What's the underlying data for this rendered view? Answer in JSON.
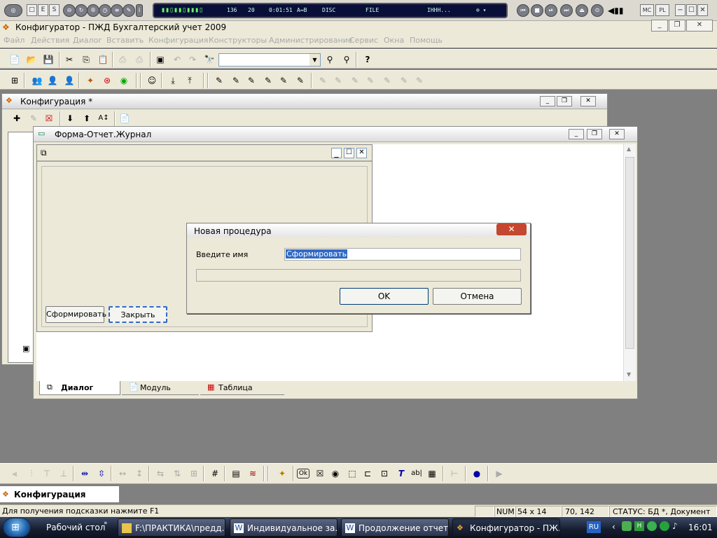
{
  "player": {
    "left_buttons": [
      "□",
      "E",
      "S"
    ],
    "lcd": {
      "track_no": "136",
      "kbps": "20",
      "time": "0:01:51",
      "ab": "A↔B",
      "disc": "DISC",
      "file": "FILE",
      "scroll": "ІННН..."
    },
    "right_buttons": [
      "MC",
      "PL"
    ]
  },
  "app": {
    "title": "Конфигуратор - ПЖД Бухгалтерский учет 2009",
    "menu": [
      "Файл",
      "Действия",
      "Диалог",
      "Вставить",
      "Конфигурация",
      "Конструкторы",
      "Администрирование",
      "Сервис",
      "Окна",
      "Помощь"
    ],
    "toolbar_combo_value": ""
  },
  "config_window": {
    "title": "Конфигурация *"
  },
  "form_window": {
    "title": "Форма-Отчет.Журнал",
    "buttons": {
      "form_button": "Сформировать",
      "close_button": "Закрыть"
    },
    "tabs": [
      {
        "label": "Диалог",
        "active": true,
        "icon": "dialog-icon"
      },
      {
        "label": "Модуль",
        "active": false,
        "icon": "module-icon"
      },
      {
        "label": "Таблица",
        "active": false,
        "icon": "table-icon"
      }
    ]
  },
  "dialog": {
    "title": "Новая процедура",
    "name_label": "Введите имя",
    "name_value": "Сформировать",
    "ok_label": "OK",
    "cancel_label": "Отмена"
  },
  "bottom_panel": {
    "tab_label": "Конфигурация"
  },
  "status": {
    "hint": "Для получения подсказки нажмите F1",
    "num": "NUM",
    "size": "54 x 14",
    "coords": "70, 142",
    "state": "СТАТУС: БД *, Документ *"
  },
  "taskbar": {
    "desktop_label": "Рабочий стол",
    "tasks": [
      {
        "label": "F:\\ПРАКТИКА\\предд...",
        "icon": "folder-icon"
      },
      {
        "label": "Индивидуальное за...",
        "icon": "word-icon"
      },
      {
        "label": "Продолжение отчет...",
        "icon": "word-icon"
      },
      {
        "label": "Конфигуратор - ПЖ...",
        "icon": "1c-icon"
      }
    ],
    "lang": "RU",
    "clock": "16:01"
  },
  "colors": {
    "accent": "#316ac5",
    "dialog_close": "#c4472f",
    "taskbar": "#1c2438"
  }
}
